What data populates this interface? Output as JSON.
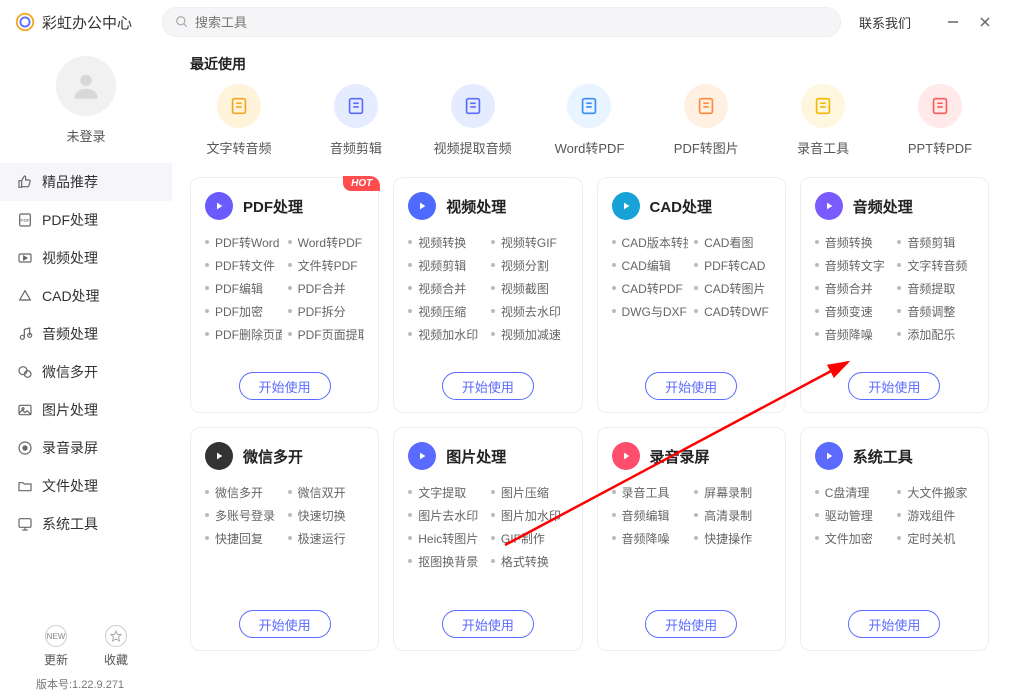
{
  "app": {
    "title": "彩虹办公中心",
    "search_placeholder": "搜索工具",
    "contact": "联系我们"
  },
  "user": {
    "name": "未登录"
  },
  "sidebar": {
    "items": [
      {
        "label": "精品推荐",
        "icon": "thumb"
      },
      {
        "label": "PDF处理",
        "icon": "pdf"
      },
      {
        "label": "视频处理",
        "icon": "video"
      },
      {
        "label": "CAD处理",
        "icon": "cad"
      },
      {
        "label": "音频处理",
        "icon": "audio"
      },
      {
        "label": "微信多开",
        "icon": "wechat"
      },
      {
        "label": "图片处理",
        "icon": "image"
      },
      {
        "label": "录音录屏",
        "icon": "record"
      },
      {
        "label": "文件处理",
        "icon": "folder"
      },
      {
        "label": "系统工具",
        "icon": "system"
      }
    ],
    "update": "更新",
    "fav": "收藏",
    "version": "版本号:1.22.9.271"
  },
  "recent": {
    "title": "最近使用",
    "items": [
      {
        "label": "文字转音频",
        "bg": "#fff3d9",
        "fg": "#f5a623"
      },
      {
        "label": "音频剪辑",
        "bg": "#e6ecff",
        "fg": "#5b6bff"
      },
      {
        "label": "视频提取音频",
        "bg": "#e6ecff",
        "fg": "#5b6bff"
      },
      {
        "label": "Word转PDF",
        "bg": "#e8f4ff",
        "fg": "#3a8bff"
      },
      {
        "label": "PDF转图片",
        "bg": "#fff0e2",
        "fg": "#ff8a3d"
      },
      {
        "label": "录音工具",
        "bg": "#fff6df",
        "fg": "#f5b800"
      },
      {
        "label": "PPT转PDF",
        "bg": "#ffe9e9",
        "fg": "#ff5a5a"
      }
    ]
  },
  "cards": [
    {
      "title": "PDF处理",
      "hot": "HOT",
      "color": "#6a5bff",
      "features": [
        "PDF转Word",
        "Word转PDF",
        "PDF转文件",
        "文件转PDF",
        "PDF编辑",
        "PDF合并",
        "PDF加密",
        "PDF拆分",
        "PDF删除页面",
        "PDF页面提取"
      ],
      "btn": "开始使用"
    },
    {
      "title": "视频处理",
      "color": "#4f6bff",
      "features": [
        "视频转换",
        "视频转GIF",
        "视频剪辑",
        "视频分割",
        "视频合并",
        "视频截图",
        "视频压缩",
        "视频去水印",
        "视频加水印",
        "视频加减速"
      ],
      "btn": "开始使用"
    },
    {
      "title": "CAD处理",
      "color": "#17a2d8",
      "features": [
        "CAD版本转换",
        "CAD看图",
        "CAD编辑",
        "PDF转CAD",
        "CAD转PDF",
        "CAD转图片",
        "DWG与DXF",
        "CAD转DWF"
      ],
      "btn": "开始使用"
    },
    {
      "title": "音频处理",
      "color": "#7a5bff",
      "features": [
        "音频转换",
        "音频剪辑",
        "音频转文字",
        "文字转音频",
        "音频合并",
        "音频提取",
        "音频变速",
        "音频调整",
        "音频降噪",
        "添加配乐"
      ],
      "btn": "开始使用"
    },
    {
      "title": "微信多开",
      "color": "#333333",
      "features": [
        "微信多开",
        "微信双开",
        "多账号登录",
        "快速切换",
        "快捷回复",
        "极速运行"
      ],
      "btn": "开始使用"
    },
    {
      "title": "图片处理",
      "color": "#5b6bff",
      "features": [
        "文字提取",
        "图片压缩",
        "图片去水印",
        "图片加水印",
        "Heic转图片",
        "GIF制作",
        "抠图换背景",
        "格式转换"
      ],
      "btn": "开始使用"
    },
    {
      "title": "录音录屏",
      "color": "#ff4d6d",
      "features": [
        "录音工具",
        "屏幕录制",
        "音频编辑",
        "高清录制",
        "音频降噪",
        "快捷操作"
      ],
      "btn": "开始使用"
    },
    {
      "title": "系统工具",
      "color": "#5b6bff",
      "features": [
        "C盘清理",
        "大文件搬家",
        "驱动管理",
        "游戏组件",
        "文件加密",
        "定时关机"
      ],
      "btn": "开始使用"
    }
  ]
}
